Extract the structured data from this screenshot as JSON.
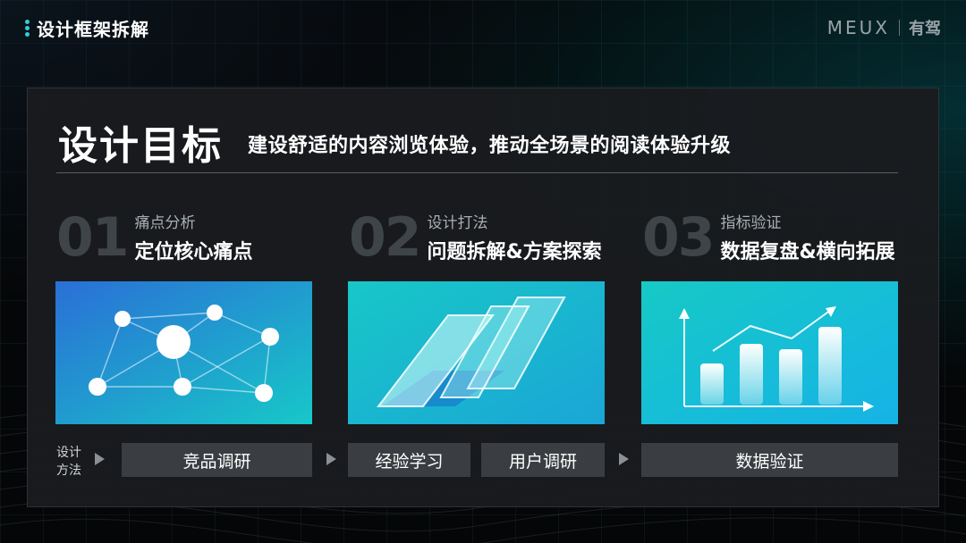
{
  "header": {
    "title": "设计框架拆解"
  },
  "brand": {
    "name": "MEUX",
    "cn": "有驾"
  },
  "goal": {
    "label": "设计目标",
    "text": "建设舒适的内容浏览体验，推动全场景的阅读体验升级"
  },
  "steps": [
    {
      "num": "01",
      "sub": "痛点分析",
      "main": "定位核心痛点"
    },
    {
      "num": "02",
      "sub": "设计打法",
      "main": "问题拆解&方案探索"
    },
    {
      "num": "03",
      "sub": "指标验证",
      "main": "数据复盘&横向拓展"
    }
  ],
  "methods": {
    "label_line1": "设计",
    "label_line2": "方法",
    "items": [
      "竞品调研",
      "经验学习",
      "用户调研",
      "数据验证"
    ]
  },
  "colors": {
    "accent": "#2ed0d8",
    "panel": "#1a1c1f",
    "box": "#3a3e42"
  }
}
